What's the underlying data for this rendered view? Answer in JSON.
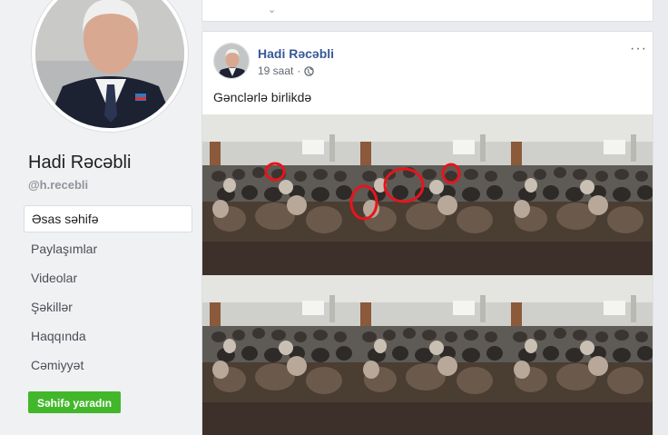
{
  "sidebar": {
    "page_name": "Hadi Rəcəbli",
    "handle": "@h.recebli",
    "nav": [
      {
        "label": "Əsas səhifə"
      },
      {
        "label": "Paylaşımlar"
      },
      {
        "label": "Videolar"
      },
      {
        "label": "Şəkillər"
      },
      {
        "label": "Haqqında"
      },
      {
        "label": "Cəmiyyət"
      }
    ],
    "create_page_label": "Səhifə yaradın"
  },
  "post": {
    "author": "Hadi Rəcəbli",
    "time": "19 saat",
    "privacy_icon": "globe-icon",
    "more_label": "···",
    "text": "Gənclərlə birlikdə",
    "highlight_color": "#e8141c"
  },
  "colors": {
    "link": "#385898",
    "button_green": "#42b72a",
    "background": "#e9ebee"
  }
}
